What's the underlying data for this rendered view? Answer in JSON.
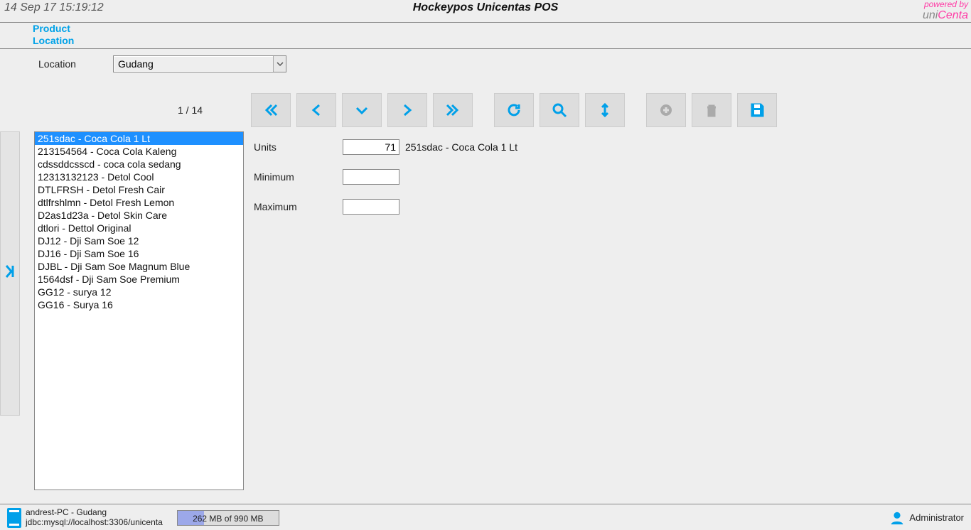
{
  "header": {
    "timestamp": "14 Sep 17 15:19:12",
    "title": "Hockeypos Unicentas POS",
    "powered_label": "powered by",
    "brand_uni": "uni",
    "brand_centa": "Centa"
  },
  "subheader": {
    "line1": "Product",
    "line2": "Location"
  },
  "locationRow": {
    "label": "Location",
    "value": "Gudang"
  },
  "pager": "1 / 14",
  "products": [
    "251sdac - Coca Cola 1 Lt",
    "213154564 - Coca Cola Kaleng",
    "cdssddcsscd - coca cola sedang",
    "12313132123 - Detol Cool",
    "DTLFRSH - Detol Fresh Cair",
    "dtlfrshlmn - Detol Fresh Lemon",
    "D2as1d23a - Detol Skin Care",
    "dtlori - Dettol Original",
    "DJ12 - Dji Sam Soe 12",
    "DJ16 - Dji Sam Soe 16",
    "DJBL - Dji Sam Soe Magnum Blue",
    "1564dsf - Dji Sam Soe Premium",
    "GG12 - surya 12",
    "GG16 - Surya 16"
  ],
  "selectedIndex": 0,
  "form": {
    "units_label": "Units",
    "units_value": "71",
    "units_product": "251sdac - Coca Cola 1 Lt",
    "min_label": "Minimum",
    "min_value": "",
    "max_label": "Maximum",
    "max_value": ""
  },
  "status": {
    "host": "andrest-PC - Gudang",
    "jdbc": "jdbc:mysql://localhost:3306/unicenta",
    "memory": "262 MB of 990 MB",
    "user": "Administrator"
  }
}
